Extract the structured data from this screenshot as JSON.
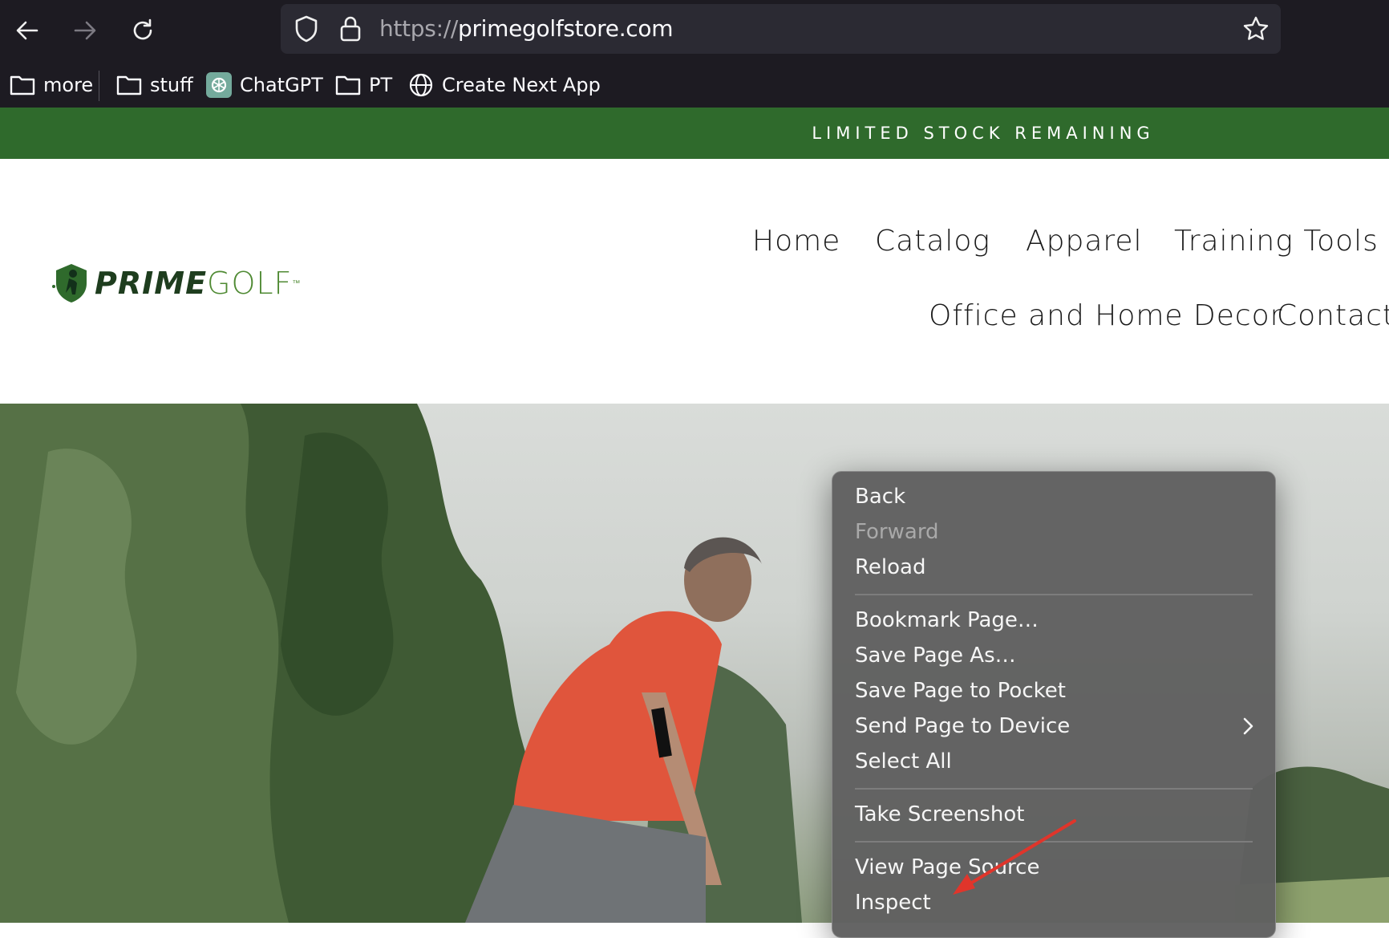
{
  "browser": {
    "url_protocol": "https://",
    "url_domain": "primegolfstore.com",
    "bookmarks": [
      {
        "label": "more",
        "icon": "folder-icon"
      },
      {
        "label": "stuff",
        "icon": "folder-icon"
      },
      {
        "label": "ChatGPT",
        "icon": "chatgpt-icon"
      },
      {
        "label": "PT",
        "icon": "folder-icon"
      },
      {
        "label": "Create Next App",
        "icon": "globe-icon"
      }
    ]
  },
  "site": {
    "announcement": "LIMITED STOCK REMAINING",
    "logo": {
      "prime": "PRIME",
      "golf": "GOLF",
      "tm": "™"
    },
    "nav": [
      "Home",
      "Catalog",
      "Apparel",
      "Training Tools",
      "Office and Home Decor",
      "Contact"
    ],
    "colors": {
      "announcement_bg": "#2f6a2c",
      "logo_dark": "#1e3d1e",
      "logo_green": "#4f8a33"
    }
  },
  "context_menu": {
    "items": [
      {
        "label": "Back",
        "enabled": true
      },
      {
        "label": "Forward",
        "enabled": false
      },
      {
        "label": "Reload",
        "enabled": true
      },
      {
        "label": "Bookmark Page…",
        "enabled": true
      },
      {
        "label": "Save Page As…",
        "enabled": true
      },
      {
        "label": "Save Page to Pocket",
        "enabled": true
      },
      {
        "label": "Send Page to Device",
        "enabled": true,
        "submenu": true
      },
      {
        "label": "Select All",
        "enabled": true
      },
      {
        "label": "Take Screenshot",
        "enabled": true
      },
      {
        "label": "View Page Source",
        "enabled": true
      },
      {
        "label": "Inspect",
        "enabled": true
      }
    ],
    "annotation_arrow_color": "#e0352b"
  }
}
